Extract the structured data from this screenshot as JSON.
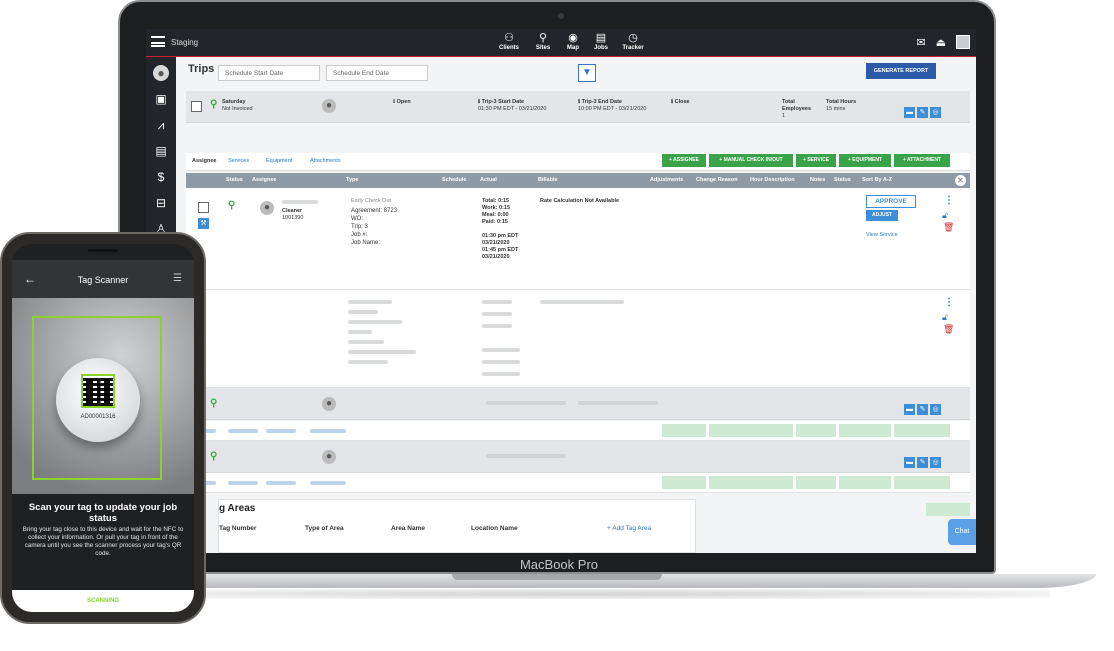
{
  "app": {
    "brand": "Staging",
    "nav": [
      {
        "label": "Clients",
        "icon": "clients-icon",
        "glyph": "⚇"
      },
      {
        "label": "Sites",
        "icon": "pin-icon",
        "glyph": "⚲"
      },
      {
        "label": "Map",
        "icon": "map-pin-icon",
        "glyph": "◉"
      },
      {
        "label": "Jobs",
        "icon": "clipboard-icon",
        "glyph": "▤"
      },
      {
        "label": "Tracker",
        "icon": "stopwatch-icon",
        "glyph": "◷"
      }
    ]
  },
  "trips": {
    "title": "Trips",
    "start_placeholder": "Schedule Start Date",
    "end_placeholder": "Schedule End Date",
    "report_button": "GENERATE REPORT"
  },
  "trip": {
    "day": "Saturday",
    "invoice": "Not Invoiced",
    "status": "Open",
    "start_label": "Trip-3 Start Date",
    "start_value": "01:30 PM EDT - 03/21/2020",
    "end_label": "Trip-3 End Date",
    "end_value": "10:00 PM EDT - 03/21/2020",
    "close_label": "Close",
    "employees_label": "Total Employees",
    "employees_value": "1",
    "hours_label": "Total Hours",
    "hours_value": "15 mins"
  },
  "tabs": [
    "Assignee",
    "Services",
    "Equipment",
    "Attachments"
  ],
  "actions": [
    "+ ASSIGNEE",
    "+ MANUAL CHECK IN/OUT",
    "+ SERVICE",
    "+ EQUIPMENT",
    "+ ATTACHMENT"
  ],
  "columns": [
    "Status",
    "Assignee",
    "Type",
    "Schedule",
    "Actual",
    "Billable",
    "Adjustments",
    "Change Reason",
    "Hour Description",
    "Notes",
    "Status",
    "Sort By A-Z"
  ],
  "assignee": {
    "role": "Cleaner",
    "id": "1001390",
    "type_line": "Early Check Out",
    "agreement": "Agreement: 8723",
    "wo": "WO:",
    "trip": "Trip: 3",
    "job_no": "Job #:",
    "job_name": "Job Name:",
    "total": "Total: 0:15",
    "work": "Work: 0:15",
    "meal": "Meal: 0:00",
    "paid": "Paid: 0:15",
    "t1": "01:30 pm EDT",
    "d1": "03/21/2020",
    "t2": "01:45 pm EDT",
    "d2": "03/21/2020",
    "billable": "Rate Calculation Not Available",
    "approve": "APPROVE",
    "adjust": "ADJUST",
    "view": "View Service"
  },
  "areas": {
    "title": "g Areas",
    "columns": [
      "Tag Number",
      "Type of Area",
      "Area Name",
      "Location Name"
    ],
    "add": "+ Add Tag Area"
  },
  "chat": "Chat",
  "macbook": "MacBook Pro",
  "phone": {
    "title": "Tag Scanner",
    "tag_id": "AD00001316",
    "headline": "Scan your tag to update your job status",
    "body": "Bring your tag close to this device and wait for the NFC to collect your information. Or pull your tag in front of the camera until you see the scanner process your tag's QR code.",
    "scanning": "SCANNING"
  },
  "colors": {
    "accent_blue": "#3d8ed6",
    "green": "#3aa34a",
    "topbar": "#22252a",
    "scanner_green": "#8bd32a"
  }
}
